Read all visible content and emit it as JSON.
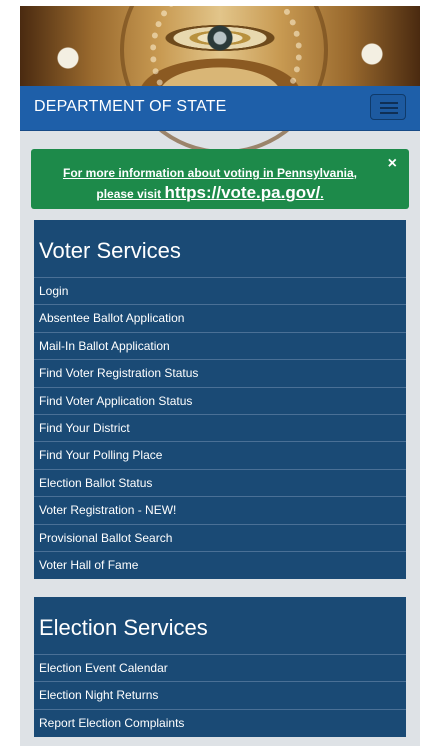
{
  "header": {
    "brand": "DEPARTMENT OF STATE"
  },
  "alert": {
    "line1": "For more information about voting in Pennsylvania,",
    "line2_prefix": "please visit",
    "link": "https://vote.pa.gov/",
    "link_suffix": ".",
    "close": "×"
  },
  "voter_services": {
    "title": "Voter Services",
    "items": [
      "Login",
      "Absentee Ballot Application",
      "Mail-In Ballot Application",
      "Find Voter Registration Status",
      "Find Voter Application Status",
      "Find Your District",
      "Find Your Polling Place",
      "Election Ballot Status",
      "Voter Registration - NEW!",
      "Provisional Ballot Search",
      "Voter Hall of Fame"
    ]
  },
  "election_services": {
    "title": "Election Services",
    "items": [
      "Election Event Calendar",
      "Election Night Returns",
      "Report Election Complaints"
    ]
  },
  "colors": {
    "navbar": "#1e5fa9",
    "alert": "#1d8a4a",
    "panel": "#1a4a75"
  }
}
